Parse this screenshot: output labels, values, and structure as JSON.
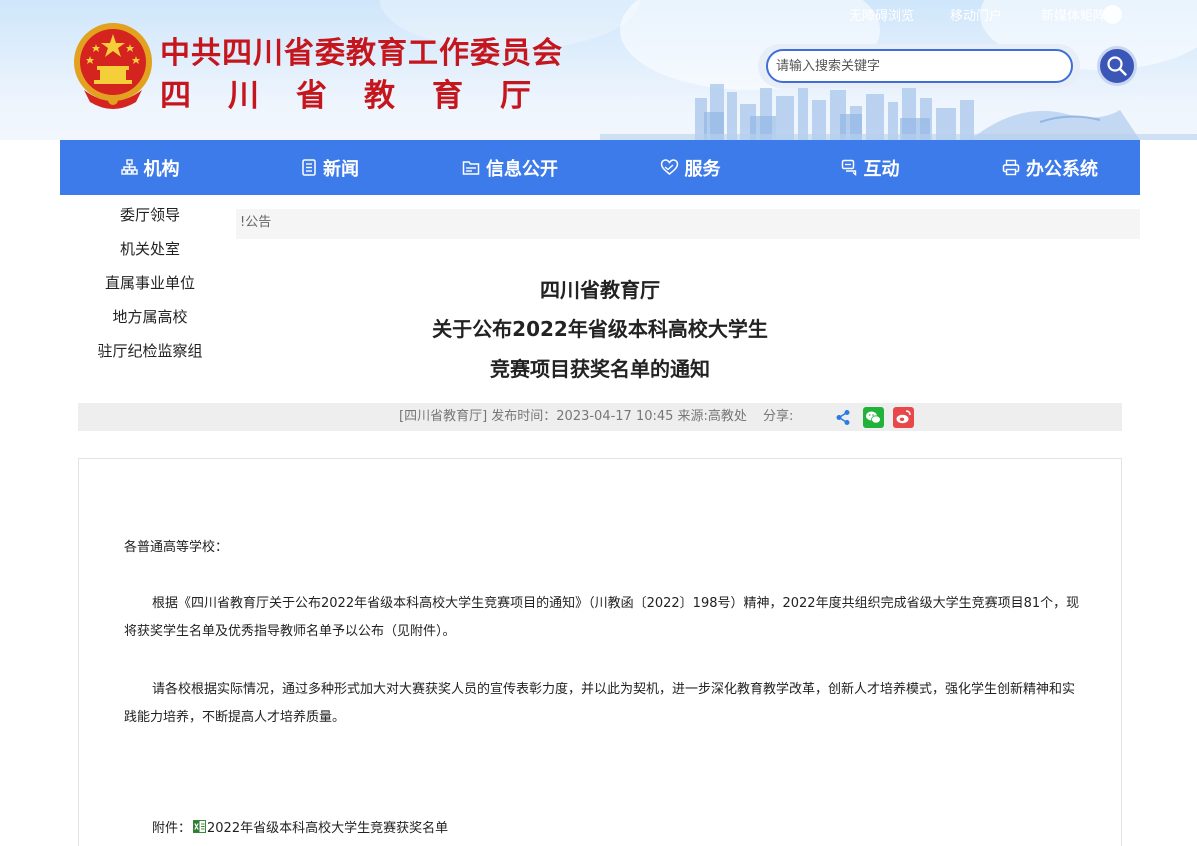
{
  "header": {
    "title": "中共四川省委教育工作委员会",
    "subtitle": "四川省教育厅",
    "top_links": [
      "无障碍浏览",
      "移动门户",
      "新媒体矩阵"
    ],
    "search_placeholder": "请输入搜索关键字"
  },
  "nav": {
    "items": [
      {
        "label": "机构",
        "icon": "org-chart-icon"
      },
      {
        "label": "新闻",
        "icon": "news-icon"
      },
      {
        "label": "信息公开",
        "icon": "folder-icon"
      },
      {
        "label": "服务",
        "icon": "heart-hand-icon"
      },
      {
        "label": "互动",
        "icon": "chat-icon"
      },
      {
        "label": "办公系统",
        "icon": "printer-icon"
      }
    ]
  },
  "dropdown": {
    "items": [
      "委厅领导",
      "机关处室",
      "直属事业单位",
      "地方属高校",
      "驻厅纪检监察组"
    ]
  },
  "breadcrumb": "!公告",
  "article": {
    "title_line1": "四川省教育厅",
    "title_line2": "关于公布2022年省级本科高校大学生",
    "title_line3": "竞赛项目获奖名单的通知",
    "meta": "[四川省教育厅]   发布时间：2023-04-17 10:45   来源:高教处",
    "share_label": "分享:",
    "greeting": "各普通高等学校：",
    "para1": "根据《四川省教育厅关于公布2022年省级本科高校大学生竞赛项目的通知》（川教函〔2022〕198号）精神，2022年度共组织完成省级大学生竞赛项目81个，现将获奖学生名单及优秀指导教师名单予以公布（见附件）。",
    "para2": "请各校根据实际情况，通过多种形式加大对大赛获奖人员的宣传表彰力度，并以此为契机，进一步深化教育教学改革，创新人才培养模式，强化学生创新精神和实践能力培养，不断提高人才培养质量。",
    "attachment_label": "附件：",
    "attachment_name": "2022年省级本科高校大学生竞赛获奖名单"
  },
  "colors": {
    "brand_red": "#c5161d",
    "nav_blue": "#3d7aea",
    "search_blue": "#3a57b8"
  }
}
